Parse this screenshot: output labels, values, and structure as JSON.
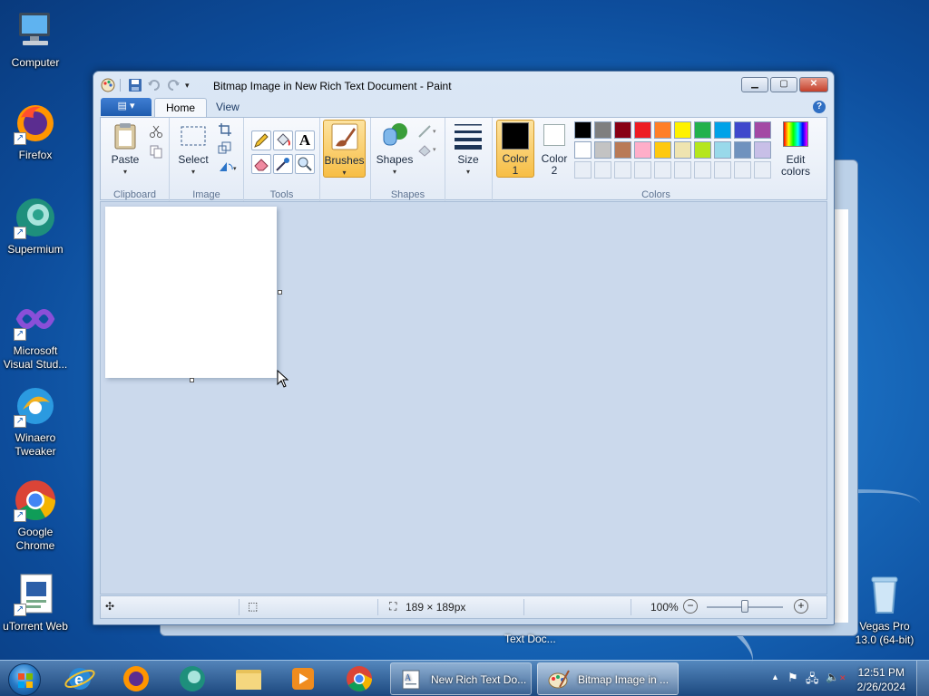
{
  "desktop": {
    "icons": [
      {
        "label": "Computer",
        "icon": "computer-icon"
      },
      {
        "label": "Firefox",
        "icon": "firefox-icon"
      },
      {
        "label": "Supermium",
        "icon": "supermium-icon"
      },
      {
        "label": "Microsoft Visual Stud...",
        "icon": "visual-studio-icon"
      },
      {
        "label": "Winaero Tweaker",
        "icon": "winaero-icon"
      },
      {
        "label": "Google Chrome",
        "icon": "chrome-icon"
      },
      {
        "label": "uTorrent Web",
        "icon": "utorrent-icon"
      },
      {
        "label": "Vegas Pro 13.0 (64-bit)",
        "icon": "recycle-bin-icon"
      }
    ],
    "behind_window_caption": "Text Doc..."
  },
  "paint": {
    "title": "Bitmap Image in New Rich Text Document - Paint",
    "tabs": [
      "Home",
      "View"
    ],
    "ribbon": {
      "clipboard": {
        "label": "Clipboard",
        "paste": "Paste"
      },
      "image": {
        "label": "Image",
        "select": "Select"
      },
      "tools": {
        "label": "Tools"
      },
      "brushes": "Brushes",
      "shapes": {
        "label": "Shapes",
        "button": "Shapes"
      },
      "size": "Size",
      "colors": {
        "label": "Colors",
        "color1_line1": "Color",
        "color1_line2": "1",
        "color2_line1": "Color",
        "color2_line2": "2",
        "edit_line1": "Edit",
        "edit_line2": "colors",
        "color1_value": "#000000",
        "color2_value": "#ffffff",
        "palette_row1": [
          "#000000",
          "#7f7f7f",
          "#880015",
          "#ed1c24",
          "#ff7f27",
          "#fff200",
          "#22b14c",
          "#00a2e8",
          "#3f48cc",
          "#a349a4"
        ],
        "palette_row2": [
          "#ffffff",
          "#c3c3c3",
          "#b97a57",
          "#ffaec9",
          "#ffc90e",
          "#efe4b0",
          "#b5e61d",
          "#99d9ea",
          "#7092be",
          "#c8bfe7"
        ]
      }
    },
    "status": {
      "size": "189 × 189px",
      "zoom": "100%",
      "zoom_level": 1.0
    }
  },
  "taskbar": {
    "tasks": [
      {
        "label": "New Rich Text Do...",
        "icon": "wordpad-icon"
      },
      {
        "label": "Bitmap Image in ...",
        "icon": "paint-icon"
      }
    ],
    "clock": {
      "time": "12:51 PM",
      "date": "2/26/2024"
    }
  }
}
